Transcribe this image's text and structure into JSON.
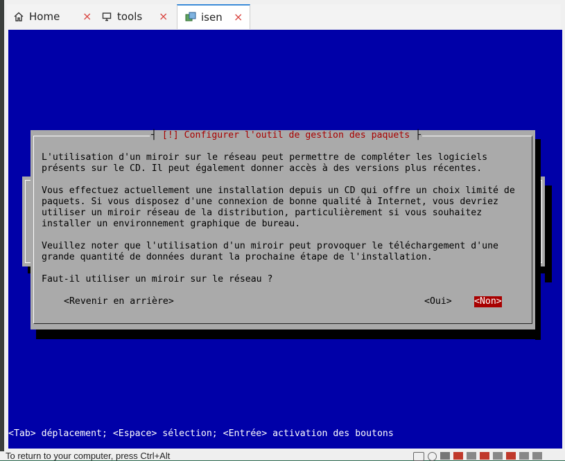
{
  "tabs": [
    {
      "label": "Home",
      "icon": "home-icon",
      "active": false
    },
    {
      "label": "tools",
      "icon": "monitor-icon",
      "active": false
    },
    {
      "label": "isen",
      "icon": "vm-icon",
      "active": true
    }
  ],
  "close_symbol": "×",
  "background_dialog": {
    "lines": []
  },
  "dialog": {
    "title_open": "┤",
    "title": " [!] Configurer l'outil de gestion des paquets ",
    "title_close": "├",
    "paragraph1": [
      "L'utilisation d'un miroir sur le réseau peut permettre de compléter les logiciels",
      "présents sur le CD. Il peut également donner accès à des versions plus récentes."
    ],
    "paragraph2": [
      "Vous effectuez actuellement une installation depuis un CD qui offre un choix limité de",
      "paquets. Si vous disposez d'une connexion de bonne qualité à Internet, vous devriez",
      "utiliser un miroir réseau de la distribution, particulièrement si vous souhaitez",
      "installer un environnement graphique de bureau."
    ],
    "paragraph3": [
      "Veuillez noter que l'utilisation d'un miroir peut provoquer le téléchargement d'une",
      "grande quantité de données durant la prochaine étape de l'installation."
    ],
    "question": "Faut-il utiliser un miroir sur le réseau ?",
    "btn_back": "<Revenir en arrière>",
    "btn_yes": "<Oui>",
    "btn_no": "<Non>"
  },
  "status_line": "<Tab> déplacement; <Espace> sélection; <Entrée> activation des boutons",
  "bottom_message": "To return to your computer, press Ctrl+Alt",
  "colors": {
    "terminal_blue": "#0000a8",
    "dialog_grey": "#aaaaaa",
    "title_red": "#a80000",
    "selected_button": "#a80000",
    "tab_accent": "#3b8bd8"
  }
}
